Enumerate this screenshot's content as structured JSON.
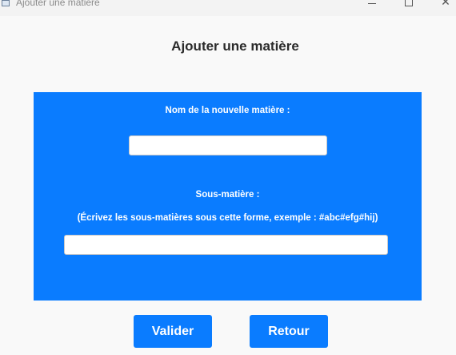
{
  "window": {
    "title": "Ajouter une matière",
    "minimize_label": "",
    "maximize_label": "",
    "close_label": "✕"
  },
  "page": {
    "title": "Ajouter une matière"
  },
  "form": {
    "name_label": "Nom de la nouvelle matière :",
    "name_value": "",
    "submatter_label": "Sous-matière :",
    "submatter_hint": "(Écrivez les sous-matières sous cette forme, exemple : #abc#efg#hij)",
    "submatter_value": ""
  },
  "buttons": {
    "validate_label": "Valider",
    "back_label": "Retour"
  },
  "colors": {
    "accent": "#0a7cff",
    "panel_text": "#ffffff",
    "background": "#f9f9f9"
  }
}
